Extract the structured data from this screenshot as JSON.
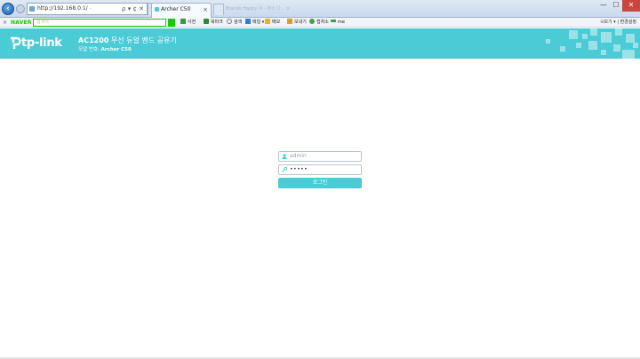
{
  "browser": {
    "address": "http://192.168.0.1/",
    "address_suffix": " - ",
    "address_tools": "ρ ▾ ¢ ✕",
    "tab_title": "Archer C50",
    "ghost_tab_text": "Brands Happy 아 - 주소 다... ×",
    "win_min": "—",
    "win_max": "☐",
    "win_close": "✕"
  },
  "toolbar": {
    "close": "×",
    "naver_label": "NAVER",
    "search_placeholder": "검색어",
    "items": [
      {
        "label": "사전",
        "color": "#3c9a3c"
      },
      {
        "label": "북마크",
        "color": "#2d8a2d"
      },
      {
        "label": "검색",
        "color": "#777777"
      },
      {
        "label": "메일 ▾",
        "color": "#2f7fd1"
      },
      {
        "label": "메모",
        "color": "#e6b422"
      },
      {
        "label": "보내기",
        "color": "#e09a1f"
      },
      {
        "label": "캡처소",
        "color": "#4b9b4b"
      },
      {
        "label": "me",
        "color": "#4b9b4b"
      }
    ],
    "right_text": "⊙보기 ▾ | 환경설정"
  },
  "header": {
    "logo_text": "tp-link",
    "product_model": "AC1200",
    "product_name": " 무선 듀얼 밴드 공유기",
    "model_label": "모델 번호: ",
    "model_number": "Archer C50"
  },
  "login": {
    "username_placeholder": "admin",
    "password_value": "•••••",
    "button_label": "로그인"
  },
  "colors": {
    "accent": "#4acbd6",
    "naver_green": "#1ec800"
  }
}
